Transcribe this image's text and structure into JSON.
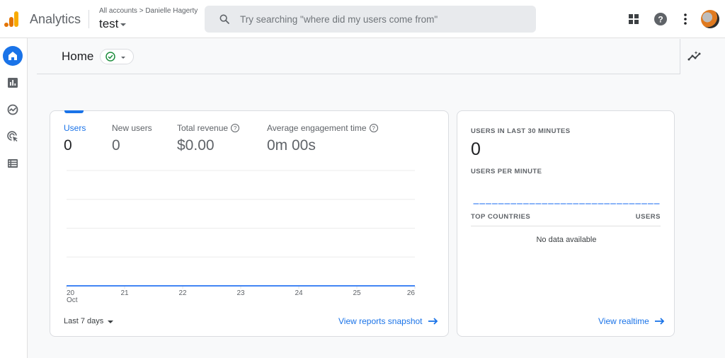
{
  "topbar": {
    "app_name": "Analytics",
    "breadcrumb": {
      "account": "All accounts",
      "separator": ">",
      "property_owner": "Danielle Hagerty"
    },
    "property_name": "test",
    "search_placeholder": "Try searching \"where did my users come from\"",
    "icons": [
      "apps-grid-icon",
      "help-icon",
      "more-vert-icon",
      "avatar"
    ]
  },
  "sidebar": {
    "items": [
      {
        "name": "home",
        "icon": "home-icon",
        "active": true
      },
      {
        "name": "reports",
        "icon": "bar-chart-icon",
        "active": false
      },
      {
        "name": "explore",
        "icon": "explore-icon",
        "active": false
      },
      {
        "name": "advertising",
        "icon": "target-cursor-icon",
        "active": false
      },
      {
        "name": "configure",
        "icon": "list-icon",
        "active": false
      }
    ]
  },
  "page": {
    "title": "Home",
    "status": "ok"
  },
  "overview_card": {
    "metrics": [
      {
        "label": "Users",
        "value": "0",
        "active": true,
        "help": false
      },
      {
        "label": "New users",
        "value": "0",
        "active": false,
        "help": false
      },
      {
        "label": "Total revenue",
        "value": "$0.00",
        "active": false,
        "help": true
      },
      {
        "label": "Average engagement time",
        "value": "0m 00s",
        "active": false,
        "help": true
      }
    ],
    "date_range": "Last 7 days",
    "link": "View reports snapshot"
  },
  "chart_data": {
    "type": "line",
    "title": "",
    "xlabel": "",
    "ylabel": "",
    "x": [
      "20",
      "21",
      "22",
      "23",
      "24",
      "25",
      "26"
    ],
    "x_sublabel": {
      "20": "Oct"
    },
    "series": [
      {
        "name": "Users",
        "values": [
          0,
          0,
          0,
          0,
          0,
          0,
          0
        ],
        "color": "#4285f4"
      }
    ],
    "y_gridlines": 5,
    "grid": true,
    "legend": "none"
  },
  "realtime_card": {
    "users_30min_label": "USERS IN LAST 30 MINUTES",
    "users_30min_value": "0",
    "per_minute_label": "USERS PER MINUTE",
    "per_minute_values": [
      0,
      0,
      0,
      0,
      0,
      0,
      0,
      0,
      0,
      0,
      0,
      0,
      0,
      0,
      0,
      0,
      0,
      0,
      0,
      0,
      0,
      0,
      0,
      0,
      0,
      0,
      0,
      0,
      0,
      0
    ],
    "table_headers": {
      "country": "TOP COUNTRIES",
      "users": "USERS"
    },
    "empty_message": "No data available",
    "link": "View realtime"
  },
  "colors": {
    "accent": "#1a73e8",
    "series_line": "#4285f4",
    "status_ok": "#1e8e3e",
    "logo_orange_light": "#f9ab00",
    "logo_orange_dark": "#e37400"
  }
}
